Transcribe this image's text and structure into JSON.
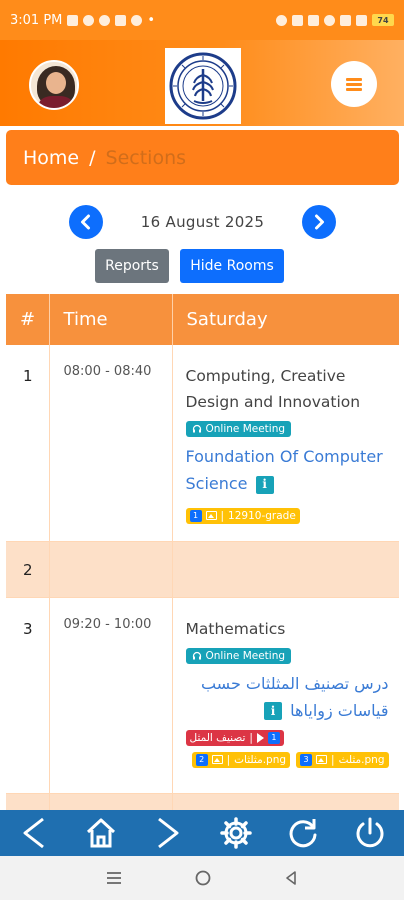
{
  "status_bar": {
    "time": "3:01 PM",
    "battery": "74"
  },
  "header": {
    "avatar_alt": "",
    "logo_alt": ""
  },
  "breadcrumb": {
    "home": "Home",
    "separator": "/",
    "current": "Sections"
  },
  "date_nav": {
    "date": "16 August 2025"
  },
  "actions": {
    "reports": "Reports",
    "hide_rooms": "Hide Rooms"
  },
  "table": {
    "headers": [
      "#",
      "Time",
      "Saturday"
    ],
    "rows": [
      {
        "num": "1",
        "time": "08:00 - 08:40",
        "course": "Computing, Creative Design and Innovation",
        "meeting_badge": "Online Meeting",
        "lesson": "Foundation Of Computer Science",
        "attachments": [
          {
            "count": "1",
            "label": "12910-grade"
          }
        ]
      },
      {
        "num": "2",
        "time": "",
        "course": ""
      },
      {
        "num": "3",
        "time": "09:20 - 10:00",
        "course": "Mathematics",
        "meeting_badge": "Online Meeting",
        "lesson": "درس تصنيف المثلثات حسب قياسات زواياها",
        "video": {
          "count": "1",
          "label": "تصنيف المثل"
        },
        "attachments": [
          {
            "count": "2",
            "label": "مثلثات.png"
          },
          {
            "count": "3",
            "label": "مثلث.png"
          }
        ]
      }
    ]
  },
  "toolbar_icons": [
    "back-icon",
    "home-icon",
    "forward-icon",
    "settings-icon",
    "refresh-icon",
    "power-icon"
  ],
  "colors": {
    "orange": "#ff8c1a",
    "blue": "#0d6efd",
    "teal": "#17a2b8",
    "yellow": "#ffc107",
    "red": "#dc3545",
    "toolbar": "#1f6fb0"
  }
}
